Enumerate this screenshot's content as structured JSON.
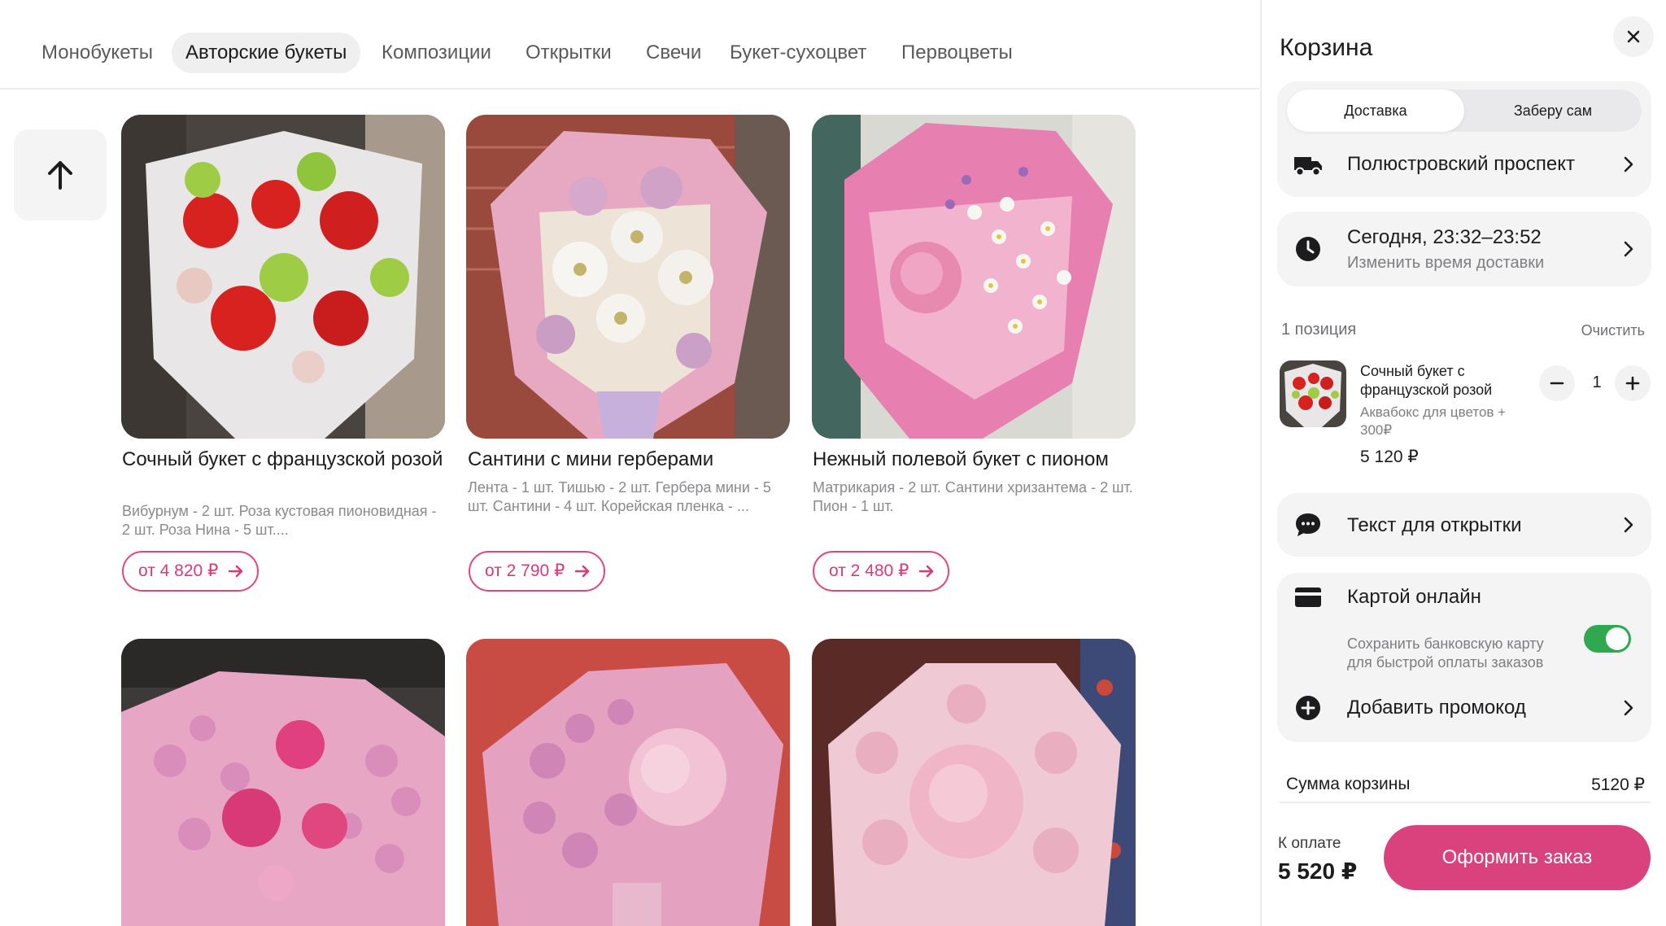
{
  "categories": [
    {
      "label": "Монобукеты",
      "active": false
    },
    {
      "label": "Авторские букеты",
      "active": true
    },
    {
      "label": "Композиции",
      "active": false
    },
    {
      "label": "Открытки",
      "active": false
    },
    {
      "label": "Свечи",
      "active": false
    },
    {
      "label": "Букет-сухоцвет",
      "active": false
    },
    {
      "label": "Первоцветы",
      "active": false
    }
  ],
  "products": [
    {
      "name": "Сочный букет с французской розой",
      "description": "Вибурнум - 2 шт. Роза кустовая пионовидная - 2 шт. Роза Нина - 5 шт....",
      "price": "от 4 820 ₽"
    },
    {
      "name": "Сантини с мини герберами",
      "description": "Лента - 1 шт. Тишью - 2 шт. Гербера мини - 5 шт. Сантини - 4 шт. Корейская пленка - ...",
      "price": "от 2 790 ₽"
    },
    {
      "name": "Нежный полевой букет с пионом",
      "description": "Матрикария - 2 шт. Сантини хризантема - 2 шт. Пион - 1 шт.",
      "price": "от 2 480 ₽"
    },
    {
      "name": "",
      "description": "",
      "price": ""
    },
    {
      "name": "",
      "description": "",
      "price": ""
    },
    {
      "name": "",
      "description": "",
      "price": ""
    }
  ],
  "cart": {
    "title": "Корзина",
    "delivery_tabs": [
      "Доставка",
      "Заберу сам"
    ],
    "selected_tab": "Доставка",
    "address": "Полюстровский проспект",
    "time": "Сегодня, 23:32–23:52",
    "time_sub": "Изменить время доставки",
    "positions": "1 позиция",
    "clear": "Очистить",
    "item": {
      "name": "Сочный букет с французской розой",
      "addon": "Аквабокс для цветов + 300₽",
      "price": "5 120 ₽",
      "qty": "1"
    },
    "card_text": "Текст для открытки",
    "payment": "Картой онлайн",
    "save_card": "Сохранить банковскую карту для быстрой оплаты заказов",
    "save_card_enabled": true,
    "promo": "Добавить промокод",
    "sum_label": "Сумма корзины",
    "sum_value": "5120 ₽",
    "pay_label": "К оплате",
    "pay_total": "5 520 ₽",
    "order_button": "Оформить заказ"
  },
  "colors": {
    "accent": "#d9427d",
    "toggle_on": "#2fa84f",
    "panel": "#f4f4f5"
  },
  "icons": [
    "arrow-up-icon",
    "arrow-right-icon",
    "close-icon",
    "truck-icon",
    "clock-icon",
    "chat-bubble-icon",
    "credit-card-icon",
    "plus-circle-icon",
    "chevron-right-icon",
    "minus-icon",
    "plus-icon"
  ]
}
